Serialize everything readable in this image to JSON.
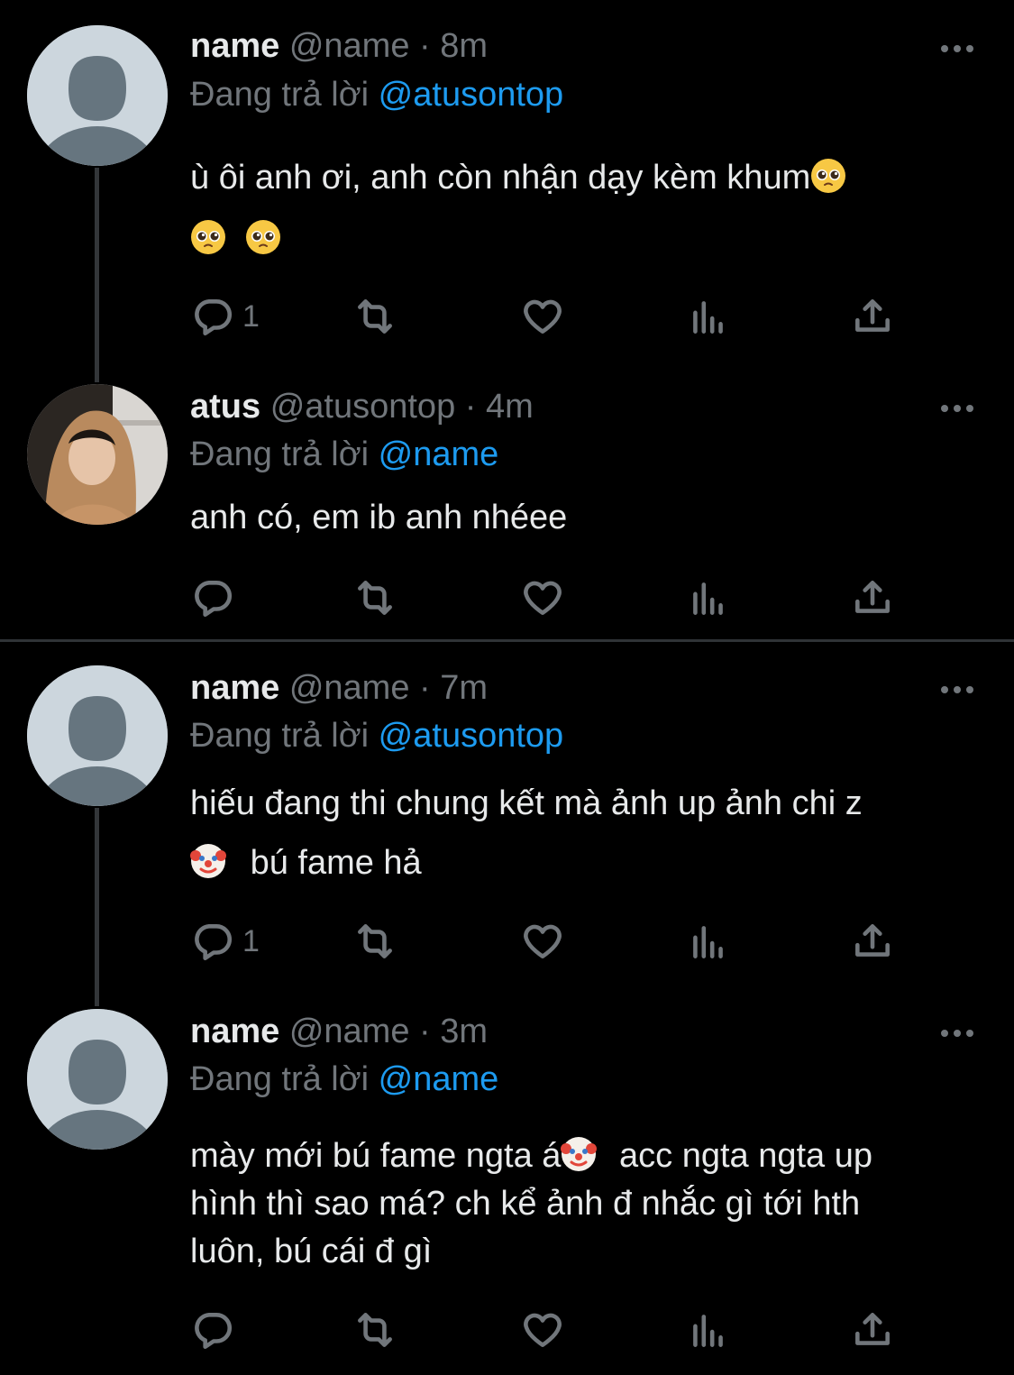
{
  "colors": {
    "background": "#000000",
    "text": "#e7e9ea",
    "muted": "#71767b",
    "mention": "#1d9bf0",
    "divider": "#2f3336"
  },
  "tweets": [
    {
      "name": "name",
      "handle": "@name",
      "separator": "·",
      "time": "8m",
      "reply_prefix": "Đang trả lời",
      "reply_to": "@atusontop",
      "text_line1": "ù ôi anh ơi, anh còn nhận dạy kèm khum",
      "avatar": "default-avatar",
      "emojis": [
        "pleading-face",
        "pleading-face",
        "pleading-face"
      ],
      "reply_count": "1"
    },
    {
      "name": "atus",
      "handle": "@atusontop",
      "separator": "·",
      "time": "4m",
      "reply_prefix": "Đang trả lời",
      "reply_to": "@name",
      "text_line1": "anh có, em ib anh nhéee",
      "avatar": "user-photo-avatar",
      "reply_count": ""
    },
    {
      "name": "name",
      "handle": "@name",
      "separator": "·",
      "time": "7m",
      "reply_prefix": "Đang trả lời",
      "reply_to": "@atusontop",
      "text_line1": "hiếu đang thi chung kết mà ảnh up ảnh chi z",
      "text_line2": "bú fame hả",
      "avatar": "default-avatar",
      "emojis": [
        "clown-face"
      ],
      "reply_count": "1"
    },
    {
      "name": "name",
      "handle": "@name",
      "separator": "·",
      "time": "3m",
      "reply_prefix": "Đang trả lời",
      "reply_to": "@name",
      "text_line1a": "mày mới bú fame ngta á",
      "text_line1b": "acc ngta ngta up",
      "text_line2": "hình thì sao má? ch kể ảnh đ nhắc gì tới hth",
      "text_line3": "luôn, bú cái đ gì",
      "avatar": "default-avatar",
      "emojis": [
        "clown-face"
      ],
      "reply_count": ""
    }
  ],
  "icons": {
    "reply": "reply-icon",
    "retweet": "retweet-icon",
    "like": "heart-icon",
    "views": "analytics-icon",
    "share": "share-icon",
    "more": "more-dots-icon"
  }
}
